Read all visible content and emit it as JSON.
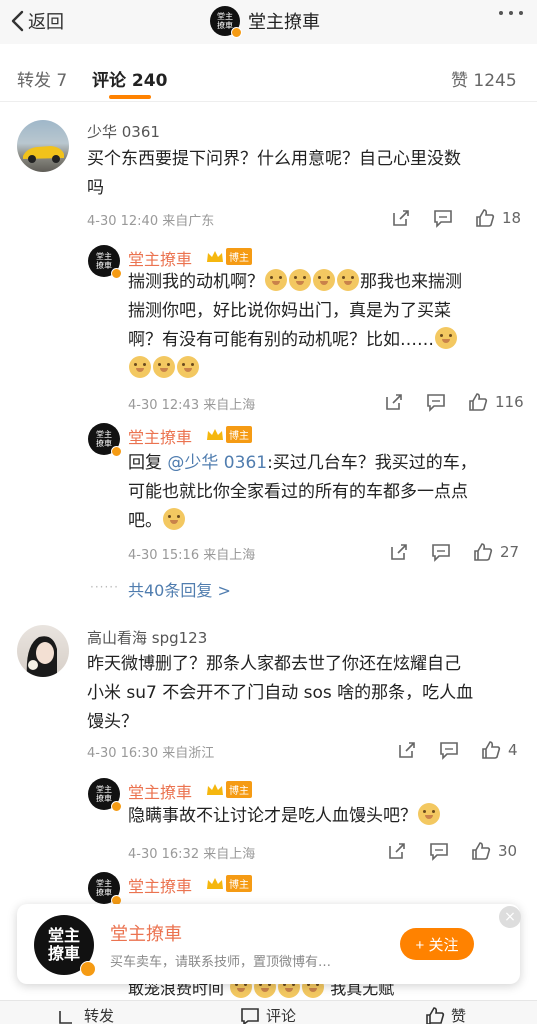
{
  "header": {
    "back_label": "返回",
    "title": "堂主撩車",
    "logo_text": "堂主\n撩車"
  },
  "tabs": [
    {
      "label": "转发 7"
    },
    {
      "label": "评论 240"
    },
    {
      "label": "赞 1245"
    }
  ],
  "comments": [
    {
      "name": "少华 0361",
      "text_lines": [
        "买个东西要提下问界？什么用意呢？自己心里没数",
        "吗"
      ],
      "meta": "4-30 12:40  来自广东",
      "likes": "18",
      "replies": [
        {
          "name": "堂主撩車",
          "badge": "博主",
          "text_lines": [
            "揣测我的动机啊？",
            "那我也来揣测",
            "揣测你吧，好比说你妈出门，真是为了买菜",
            "啊？有没有可能有别的动机呢？比如……"
          ],
          "meta": "4-30 12:43  来自上海",
          "likes": "116"
        },
        {
          "name": "堂主撩車",
          "badge": "博主",
          "reply_prefix": "回复",
          "mention": "@少华 0361",
          "text_lines": [
            ":买过几台车？我买过的车，",
            "可能也就比你全家看过的所有的车都多一点点",
            "吧。"
          ],
          "meta": "4-30 15:16  来自上海",
          "likes": "27"
        }
      ],
      "more_replies": "共40条回复 >"
    },
    {
      "name": "高山看海 spg123",
      "text_lines": [
        "昨天微博删了？那条人家都去世了你还在炫耀自己",
        "小米 su7 不会开不了门自动 sos 啥的那条，吃人血",
        "馒头？"
      ],
      "meta": "4-30 16:30  来自浙江",
      "likes": "4",
      "replies": [
        {
          "name": "堂主撩車",
          "badge": "博主",
          "text_lines": [
            "隐瞒事故不让讨论才是吃人血馒头吧？"
          ],
          "meta": "4-30 16:32  来自上海",
          "likes": "30"
        },
        {
          "name": "堂主撩車",
          "badge": "博主",
          "text_lines": [
            "敢笼浪费时间",
            "我真无赋"
          ]
        }
      ]
    }
  ],
  "float_card": {
    "name": "堂主撩車",
    "desc": "买车卖车，请联系技师，置顶微博有…",
    "follow_label": "+ 关注",
    "close_label": "×"
  },
  "bottom_bar": {
    "repost": "转发",
    "comment": "评论",
    "like": "赞"
  },
  "colors": {
    "accent": "#ff8200",
    "blogger_name": "#eb7350",
    "link": "#507daf",
    "badge": "#f59b14"
  }
}
